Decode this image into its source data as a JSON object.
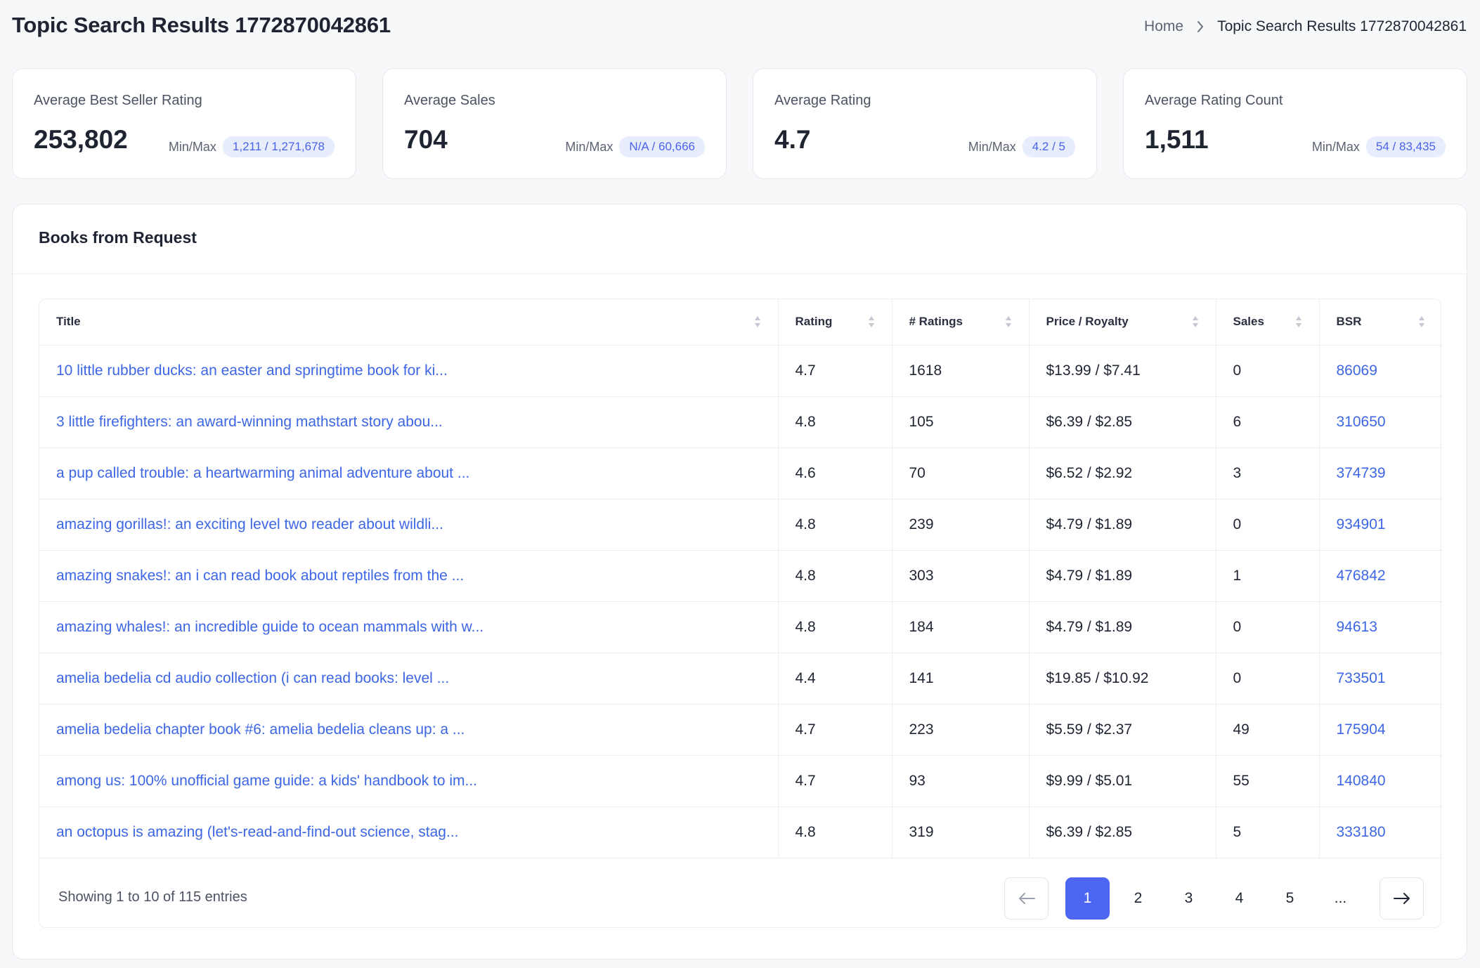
{
  "header": {
    "title": "Topic Search Results 1772870042861",
    "breadcrumb": {
      "home": "Home",
      "current": "Topic Search Results 1772870042861"
    }
  },
  "stats": [
    {
      "label": "Average Best Seller Rating",
      "value": "253,802",
      "minmax_label": "Min/Max",
      "minmax": "1,211 / 1,271,678"
    },
    {
      "label": "Average Sales",
      "value": "704",
      "minmax_label": "Min/Max",
      "minmax": "N/A / 60,666"
    },
    {
      "label": "Average Rating",
      "value": "4.7",
      "minmax_label": "Min/Max",
      "minmax": "4.2 / 5"
    },
    {
      "label": "Average Rating Count",
      "value": "1,511",
      "minmax_label": "Min/Max",
      "minmax": "54 / 83,435"
    }
  ],
  "table": {
    "title": "Books from Request",
    "columns": [
      "Title",
      "Rating",
      "# Ratings",
      "Price / Royalty",
      "Sales",
      "BSR"
    ],
    "rows": [
      {
        "title": "10 little rubber ducks: an easter and springtime book for ki...",
        "rating": "4.7",
        "ratings": "1618",
        "price": "$13.99 / $7.41",
        "sales": "0",
        "bsr": "86069"
      },
      {
        "title": "3 little firefighters: an award-winning mathstart story abou...",
        "rating": "4.8",
        "ratings": "105",
        "price": "$6.39 / $2.85",
        "sales": "6",
        "bsr": "310650"
      },
      {
        "title": "a pup called trouble: a heartwarming animal adventure about ...",
        "rating": "4.6",
        "ratings": "70",
        "price": "$6.52 / $2.92",
        "sales": "3",
        "bsr": "374739"
      },
      {
        "title": "amazing gorillas!: an exciting level two reader about wildli...",
        "rating": "4.8",
        "ratings": "239",
        "price": "$4.79 / $1.89",
        "sales": "0",
        "bsr": "934901"
      },
      {
        "title": "amazing snakes!: an i can read book about reptiles from the ...",
        "rating": "4.8",
        "ratings": "303",
        "price": "$4.79 / $1.89",
        "sales": "1",
        "bsr": "476842"
      },
      {
        "title": "amazing whales!: an incredible guide to ocean mammals with w...",
        "rating": "4.8",
        "ratings": "184",
        "price": "$4.79 / $1.89",
        "sales": "0",
        "bsr": "94613"
      },
      {
        "title": "amelia bedelia cd audio collection (i can read books: level ...",
        "rating": "4.4",
        "ratings": "141",
        "price": "$19.85 / $10.92",
        "sales": "0",
        "bsr": "733501"
      },
      {
        "title": "amelia bedelia chapter book #6: amelia bedelia cleans up: a ...",
        "rating": "4.7",
        "ratings": "223",
        "price": "$5.59 / $2.37",
        "sales": "49",
        "bsr": "175904"
      },
      {
        "title": "among us: 100% unofficial game guide: a kids' handbook to im...",
        "rating": "4.7",
        "ratings": "93",
        "price": "$9.99 / $5.01",
        "sales": "55",
        "bsr": "140840"
      },
      {
        "title": "an octopus is amazing (let's-read-and-find-out science, stag...",
        "rating": "4.8",
        "ratings": "319",
        "price": "$6.39 / $2.85",
        "sales": "5",
        "bsr": "333180"
      }
    ],
    "footer": {
      "showing": "Showing 1 to 10 of 115 entries",
      "pages": [
        "1",
        "2",
        "3",
        "4",
        "5",
        "..."
      ],
      "active_page": "1"
    }
  },
  "colors": {
    "accent": "#4d66f2",
    "link": "#3d66e6",
    "pill_bg": "#e8edfd"
  },
  "icons": {
    "breadcrumb_separator": "chevron-right-icon",
    "sort": "sort-icon",
    "prev": "arrow-left-icon",
    "next": "arrow-right-icon"
  }
}
